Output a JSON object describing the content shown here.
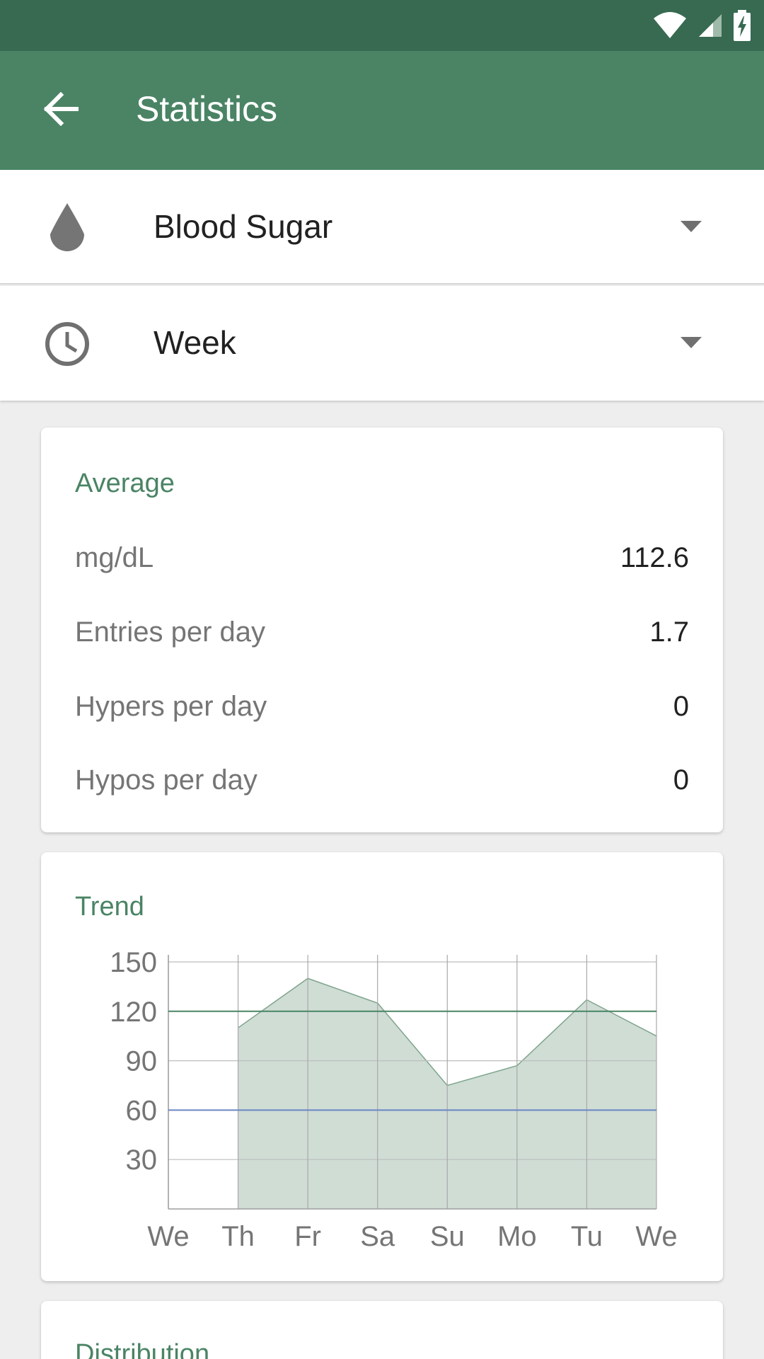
{
  "status_bar": {
    "icons": [
      "wifi-icon",
      "cellular-signal-icon",
      "battery-charging-icon"
    ]
  },
  "app_bar": {
    "title": "Statistics",
    "back_icon": "arrow-left-icon"
  },
  "selectors": [
    {
      "label": "Blood Sugar",
      "icon": "drop-icon"
    },
    {
      "label": "Week",
      "icon": "clock-icon"
    }
  ],
  "average": {
    "title": "Average",
    "rows": [
      {
        "label": "mg/dL",
        "value": "112.6"
      },
      {
        "label": "Entries per day",
        "value": "1.7"
      },
      {
        "label": "Hypers per day",
        "value": "0"
      },
      {
        "label": "Hypos per day",
        "value": "0"
      }
    ]
  },
  "trend": {
    "title": "Trend"
  },
  "distribution": {
    "title": "Distribution"
  },
  "colors": {
    "primary": "#4a8465",
    "primary_dark": "#376a51",
    "hyper_line": "#4a8465",
    "hypo_line": "#6b86c2",
    "area_fill": "#cfddd5"
  },
  "chart_data": {
    "type": "area",
    "title": "Trend",
    "categories": [
      "We",
      "Th",
      "Fr",
      "Sa",
      "Su",
      "Mo",
      "Tu",
      "We"
    ],
    "series": [
      {
        "values": [
          null,
          110,
          140,
          125,
          75,
          87,
          127,
          105
        ]
      }
    ],
    "reference_lines": [
      {
        "value": 120,
        "color": "#4a8465"
      },
      {
        "value": 60,
        "color": "#6b86c2"
      }
    ],
    "y_ticks": [
      150,
      120,
      90,
      60,
      30
    ],
    "ylim": [
      0,
      150
    ],
    "grid": true,
    "xlabel": "",
    "ylabel": ""
  }
}
